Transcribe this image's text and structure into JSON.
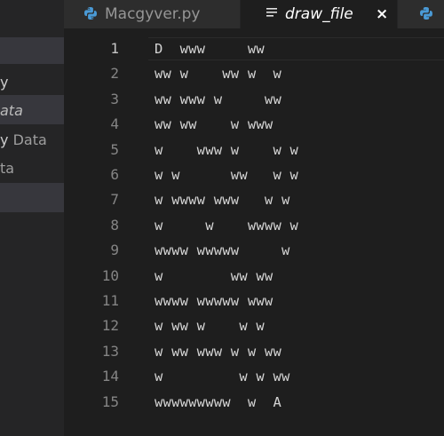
{
  "sidebar": {
    "items": [
      {
        "text": "y",
        "suffix": ""
      },
      {
        "text": "ata",
        "suffix": ""
      },
      {
        "text": "y",
        "suffix": "Data"
      },
      {
        "text": "ta",
        "suffix": ""
      }
    ]
  },
  "tabs": [
    {
      "label": "Macgyver.py",
      "icon": "python-icon",
      "active": false
    },
    {
      "label": "draw_file",
      "icon": "text-lines-icon",
      "active": true,
      "close": "×"
    }
  ],
  "editor": {
    "current_line": 1,
    "lines": [
      {
        "n": "1",
        "text": "D  www     ww"
      },
      {
        "n": "2",
        "text": "ww w    ww w  w"
      },
      {
        "n": "3",
        "text": "ww www w     ww"
      },
      {
        "n": "4",
        "text": "ww ww    w www"
      },
      {
        "n": "5",
        "text": "w    www w    w w"
      },
      {
        "n": "6",
        "text": "w w      ww   w w"
      },
      {
        "n": "7",
        "text": "w wwww www   w w"
      },
      {
        "n": "8",
        "text": "w     w    wwww w"
      },
      {
        "n": "9",
        "text": "wwww wwwww     w"
      },
      {
        "n": "10",
        "text": "w        ww ww"
      },
      {
        "n": "11",
        "text": "wwww wwwww www"
      },
      {
        "n": "12",
        "text": "w ww w    w w"
      },
      {
        "n": "13",
        "text": "w ww www w w ww"
      },
      {
        "n": "14",
        "text": "w         w w ww"
      },
      {
        "n": "15",
        "text": "wwwwwwwww  w  A"
      }
    ]
  },
  "colors": {
    "editor_bg": "#1e1e1e",
    "sidebar_bg": "#252526",
    "sidebar_selected": "#37373d",
    "python_blue": "#4a9ad6"
  }
}
